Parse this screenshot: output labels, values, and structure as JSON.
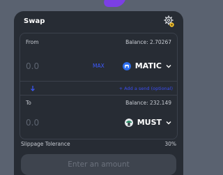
{
  "widget": {
    "title": "Swap",
    "settings_icon": "gear-icon"
  },
  "from": {
    "label": "From",
    "balance": "Balance: 2.70267",
    "amount_placeholder": "0.0",
    "max_label": "MAX",
    "token": "MATIC",
    "token_icon": "matic-icon",
    "token_color": "#2b6def"
  },
  "middle": {
    "arrow_icon": "arrow-down-icon",
    "add_send_label": "+ Add a send (optional)"
  },
  "to": {
    "label": "To",
    "balance": "Balance: 232.149",
    "amount_placeholder": "0.0",
    "token": "MUST",
    "token_icon": "must-icon"
  },
  "slippage": {
    "label": "Slippage Tolerance",
    "value": "30%"
  },
  "action": {
    "button_label": "Enter an amount"
  },
  "colors": {
    "accent": "#3d5aff",
    "card": "#272c34",
    "background": "#5a6270"
  }
}
